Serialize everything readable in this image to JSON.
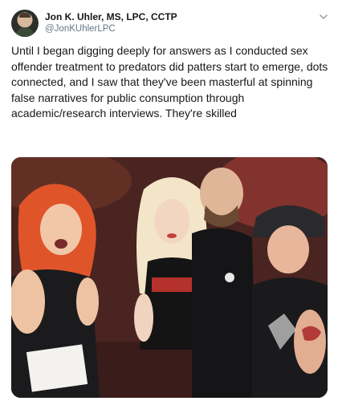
{
  "tweet": {
    "author": {
      "name": "Jon K. Uhler, MS, LPC, CCTP",
      "handle": "@JonKUhlerLPC",
      "avatar_icon": "profile-avatar"
    },
    "menu_icon": "chevron-down-icon",
    "text": "Until I began digging deeply for answers as I conducted sex offender treatment to predators did patters start to emerge, dots connected, and I saw that they've been masterful at spinning false narratives for public consumption through academic/research interviews. They're skilled",
    "media": {
      "type": "photo"
    }
  },
  "colors": {
    "text_primary": "#14171a",
    "text_secondary": "#657786",
    "background": "#ffffff"
  }
}
